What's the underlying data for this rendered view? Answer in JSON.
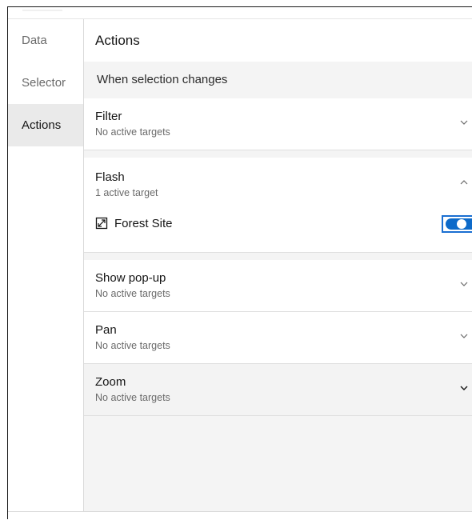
{
  "sidebar": {
    "items": [
      {
        "label": "Data"
      },
      {
        "label": "Selector"
      },
      {
        "label": "Actions"
      }
    ]
  },
  "main": {
    "heading": "Actions",
    "section_header": "When selection changes",
    "actions": [
      {
        "title": "Filter",
        "subtitle": "No active targets",
        "state": "collapsed"
      },
      {
        "title": "Flash",
        "subtitle": "1 active target",
        "state": "expanded",
        "targets": [
          {
            "label": "Forest Site",
            "icon": "layer-icon",
            "enabled": true
          }
        ]
      },
      {
        "title": "Show pop-up",
        "subtitle": "No active targets",
        "state": "collapsed"
      },
      {
        "title": "Pan",
        "subtitle": "No active targets",
        "state": "collapsed"
      },
      {
        "title": "Zoom",
        "subtitle": "No active targets",
        "state": "collapsed-hover"
      }
    ]
  },
  "icons": {
    "collapsed": "chevron-down-icon",
    "expanded": "chevron-up-icon"
  },
  "colors": {
    "toggle_on": "#0d6ac9",
    "focus_outline": "#1a6fd1",
    "active_nav_bg": "#eaeaea"
  }
}
